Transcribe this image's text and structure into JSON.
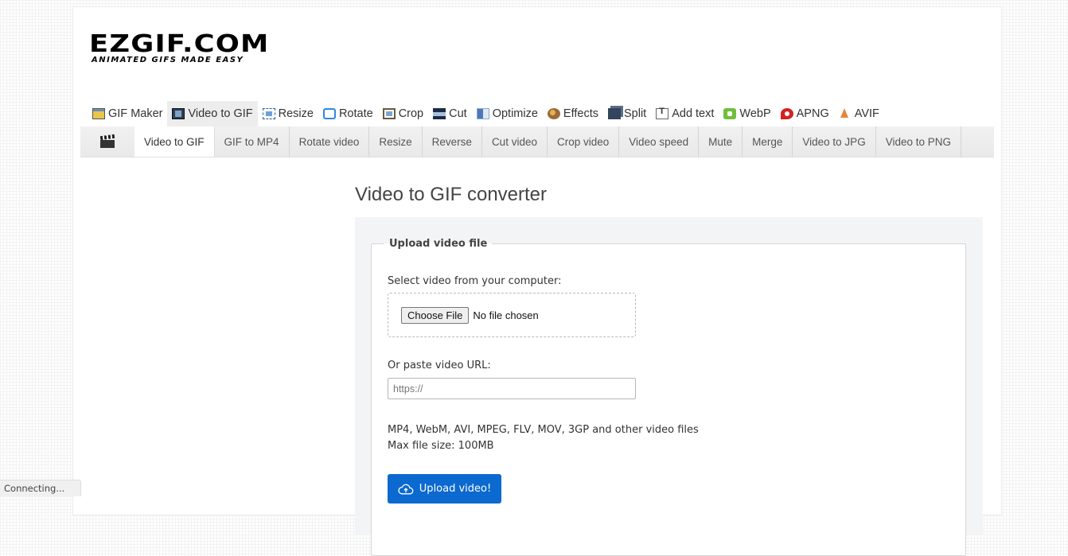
{
  "logo": {
    "main": "EZGIF.COM",
    "tagline": "ANIMATED GIFS MADE EASY"
  },
  "main_nav": {
    "items": [
      {
        "label": "GIF Maker",
        "icon": "gif-maker-icon",
        "active": false
      },
      {
        "label": "Video to GIF",
        "icon": "film-icon",
        "active": true
      },
      {
        "label": "Resize",
        "icon": "resize-icon",
        "active": false
      },
      {
        "label": "Rotate",
        "icon": "rotate-icon",
        "active": false
      },
      {
        "label": "Crop",
        "icon": "crop-icon",
        "active": false
      },
      {
        "label": "Cut",
        "icon": "cut-icon",
        "active": false
      },
      {
        "label": "Optimize",
        "icon": "optimize-icon",
        "active": false
      },
      {
        "label": "Effects",
        "icon": "palette-icon",
        "active": false
      },
      {
        "label": "Split",
        "icon": "split-icon",
        "active": false
      },
      {
        "label": "Add text",
        "icon": "add-text-icon",
        "active": false
      },
      {
        "label": "WebP",
        "icon": "webp-icon",
        "active": false
      },
      {
        "label": "APNG",
        "icon": "apng-icon",
        "active": false
      },
      {
        "label": "AVIF",
        "icon": "avif-icon",
        "active": false
      }
    ]
  },
  "sub_nav": {
    "icon": "clapperboard-icon",
    "tabs": [
      {
        "label": "Video to GIF",
        "active": true
      },
      {
        "label": "GIF to MP4",
        "active": false
      },
      {
        "label": "Rotate video",
        "active": false
      },
      {
        "label": "Resize",
        "active": false
      },
      {
        "label": "Reverse",
        "active": false
      },
      {
        "label": "Cut video",
        "active": false
      },
      {
        "label": "Crop video",
        "active": false
      },
      {
        "label": "Video speed",
        "active": false
      },
      {
        "label": "Mute",
        "active": false
      },
      {
        "label": "Merge",
        "active": false
      },
      {
        "label": "Video to JPG",
        "active": false
      },
      {
        "label": "Video to PNG",
        "active": false
      }
    ]
  },
  "main": {
    "title": "Video to GIF converter",
    "upload": {
      "legend": "Upload video file",
      "select_label": "Select video from your computer:",
      "choose_file_label": "Choose File",
      "no_file_text": "No file chosen",
      "url_label": "Or paste video URL:",
      "url_placeholder": "https://",
      "url_value": "",
      "formats_text": "MP4, WebM, AVI, MPEG, FLV, MOV, 3GP and other video files",
      "max_size_text": "Max file size: 100MB",
      "upload_button_label": "Upload video!",
      "upload_button_icon": "cloud-upload-icon"
    }
  },
  "status_bar": {
    "text": "Connecting..."
  },
  "colors": {
    "accent_button": "#0b69d0",
    "active_tab_bg": "#ffffff",
    "subnav_bg": "#ececec",
    "panel_bg": "#f3f4f6"
  }
}
